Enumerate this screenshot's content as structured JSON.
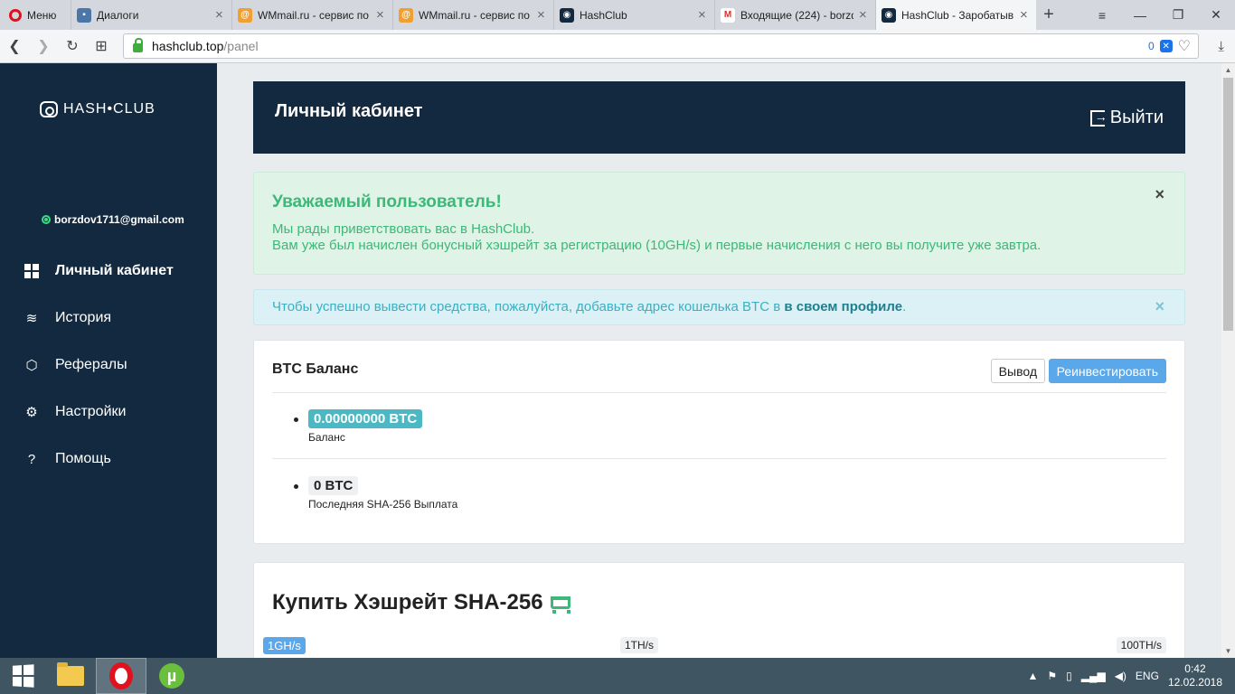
{
  "browser": {
    "menu_label": "Меню",
    "tabs": [
      {
        "label": "Диалоги",
        "icon": "chat-icon",
        "color": "#4a76a8"
      },
      {
        "label": "WMmail.ru - сервис по",
        "icon": "wmmail-icon",
        "color": "#f0a030"
      },
      {
        "label": "WMmail.ru - сервис по",
        "icon": "wmmail-icon",
        "color": "#f0a030"
      },
      {
        "label": "HashClub",
        "icon": "hashclub-icon",
        "color": "#13293f"
      },
      {
        "label": "Входящие (224) - borzd",
        "icon": "gmail-icon",
        "color": "#d93025"
      },
      {
        "label": "HashClub - Заробатыв",
        "icon": "hashclub-icon",
        "color": "#13293f"
      }
    ],
    "url_host": "hashclub.top",
    "url_path": "/panel",
    "adblock_count": "0"
  },
  "sidebar": {
    "logo_text": "HASH•CLUB",
    "user_email": "borzdov1711@gmail.com",
    "items": [
      {
        "label": "Личный кабинет",
        "icon": "dashboard-icon"
      },
      {
        "label": "История",
        "icon": "layers-icon"
      },
      {
        "label": "Рефералы",
        "icon": "cube-icon"
      },
      {
        "label": "Настройки",
        "icon": "user-cog-icon"
      },
      {
        "label": "Помощь",
        "icon": "question-icon"
      }
    ]
  },
  "header": {
    "title": "Личный кабинет",
    "logout_label": "Выйти"
  },
  "alerts": {
    "welcome_title": "Уважаемый пользователь!",
    "welcome_line1": "Мы рады приветствовать вас в HashClub.",
    "welcome_line2": "Вам уже был начислен бонусный хэшрейт за регистрацию (10GH/s) и первые начисления с него вы получите уже завтра.",
    "info_text": "Чтобы успешно вывести средства, пожалуйста, добавьте адрес кошелька BTC в ",
    "info_link": "в своем профиле",
    "info_end": ".",
    "close_glyph": "×"
  },
  "balance": {
    "title": "BTC Баланс",
    "withdraw_label": "Вывод",
    "reinvest_label": "Реинвестировать",
    "balance_value": "0.00000000 BTC",
    "balance_caption": "Баланс",
    "last_payout_value": "0 BTC",
    "last_payout_caption": "Последняя SHA-256 Выплата"
  },
  "buy": {
    "title": "Купить Хэшрейт SHA-256",
    "range_min": "1GH/s",
    "range_mid": "1TH/s",
    "range_max": "100TH/s"
  },
  "taskbar": {
    "language": "ENG",
    "time": "0:42",
    "date": "12.02.2018"
  },
  "colors": {
    "sidebar_bg": "#13293f",
    "success": "#3cb878",
    "info": "#3ab0c3",
    "primary": "#5aa7ea"
  }
}
